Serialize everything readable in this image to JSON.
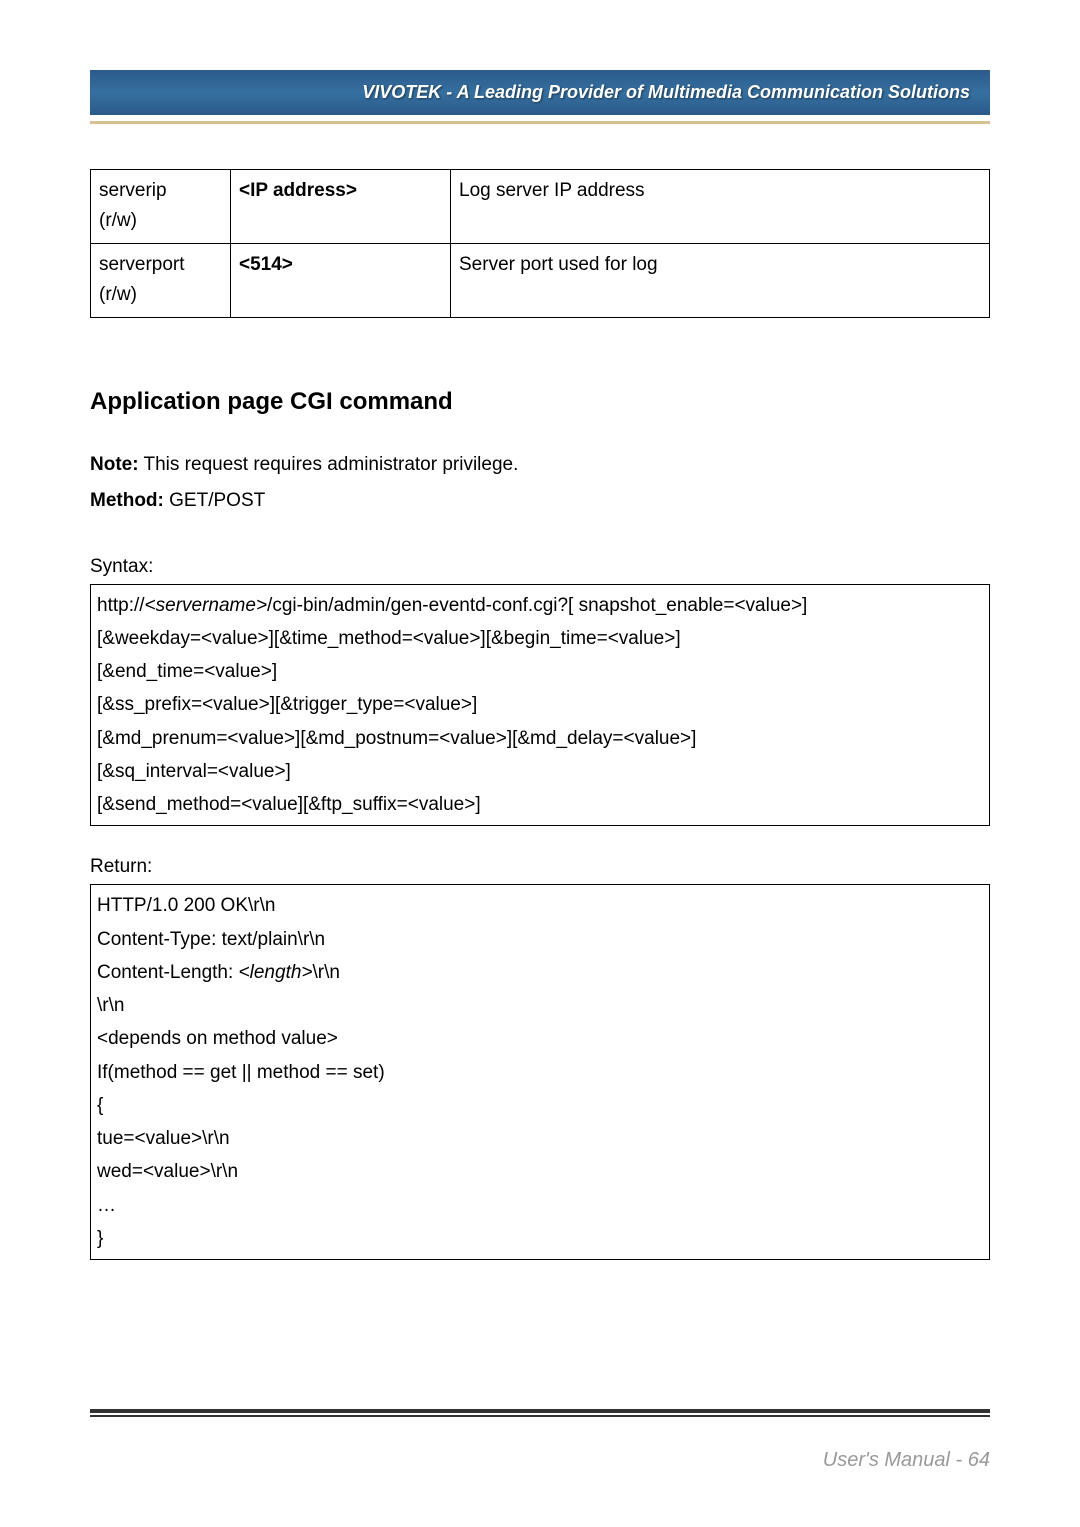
{
  "header": {
    "banner_text": "VIVOTEK - A Leading Provider of Multimedia Communication Solutions"
  },
  "param_table": {
    "rows": [
      {
        "name": "serverip",
        "rw": "(r/w)",
        "value": "<IP address>",
        "desc": "Log server IP address"
      },
      {
        "name": "serverport",
        "rw": "(r/w)",
        "value": "<514>",
        "desc": "Server port used for log"
      }
    ]
  },
  "section": {
    "heading": "Application page CGI command",
    "note_label": "Note:",
    "note_text": " This request requires administrator privilege.",
    "method_label": "Method:",
    "method_text": " GET/POST"
  },
  "syntax": {
    "label": "Syntax:",
    "line_prefix": "http://",
    "servername": "<servername>",
    "line_rest_1": "/cgi-bin/admin/gen-eventd-conf.cgi?[ snapshot_enable=<value>]",
    "line2": "[&weekday=<value>][&time_method=<value>][&begin_time=<value>]",
    "line3": "[&end_time=<value>]",
    "line4": "[&ss_prefix=<value>][&trigger_type=<value>]",
    "line5": "[&md_prenum=<value>][&md_postnum=<value>][&md_delay=<value>]",
    "line6": "[&sq_interval=<value>]",
    "line7": "[&send_method=<value][&ftp_suffix=<value>]"
  },
  "return_block": {
    "label": "Return:",
    "line1": "HTTP/1.0 200 OK\\r\\n",
    "line2": "Content-Type: text/plain\\r\\n",
    "line3_prefix": "Content-Length: ",
    "line3_italic": "<length>",
    "line3_suffix": "\\r\\n",
    "line4": "\\r\\n",
    "line5": "<depends on method value>",
    "line6": "If(method == get || method == set)",
    "line7": "{",
    "line8": " tue=<value>\\r\\n",
    "line9": " wed=<value>\\r\\n",
    "line10": " …",
    "line11": "}"
  },
  "footer": {
    "text": "User's Manual - 64"
  }
}
